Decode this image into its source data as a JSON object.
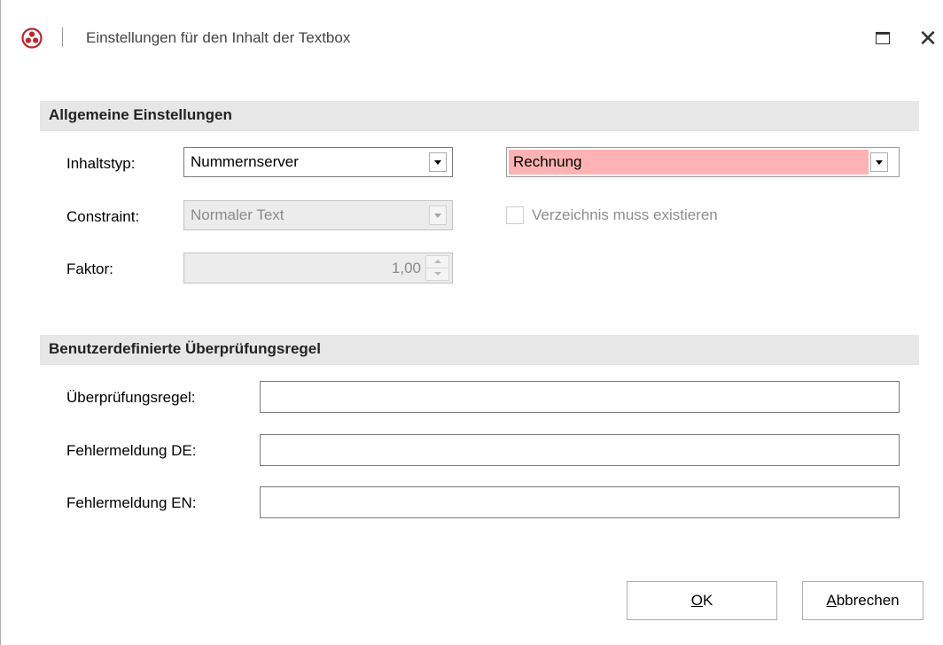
{
  "window": {
    "title": "Einstellungen für den Inhalt der Textbox",
    "maximize_icon": "maximize-icon",
    "close_icon": "close-icon",
    "close_glyph": "✕"
  },
  "colors": {
    "invalid_fill": "#fdb3b3",
    "section_header_bg": "#e7e7e7",
    "disabled_bg": "#ececec"
  },
  "general": {
    "header": "Allgemeine Einstellungen",
    "content_type_label": "Inhaltstyp:",
    "content_type_value": "Nummernserver",
    "series_value": "Rechnung",
    "constraint_label": "Constraint:",
    "constraint_value": "Normaler Text",
    "directory_checkbox_label": "Verzeichnis muss existieren",
    "directory_checked": false,
    "factor_label": "Faktor:",
    "factor_value": "1,00"
  },
  "validation": {
    "header": "Benutzerdefinierte Überprüfungsregel",
    "rule_label": "Überprüfungsregel:",
    "rule_value": "",
    "error_de_label": "Fehlermeldung DE:",
    "error_de_value": "",
    "error_en_label": "Fehlermeldung EN:",
    "error_en_value": ""
  },
  "buttons": {
    "ok_mnemonic": "O",
    "ok_rest": "K",
    "cancel_mnemonic": "A",
    "cancel_rest": "bbrechen"
  }
}
